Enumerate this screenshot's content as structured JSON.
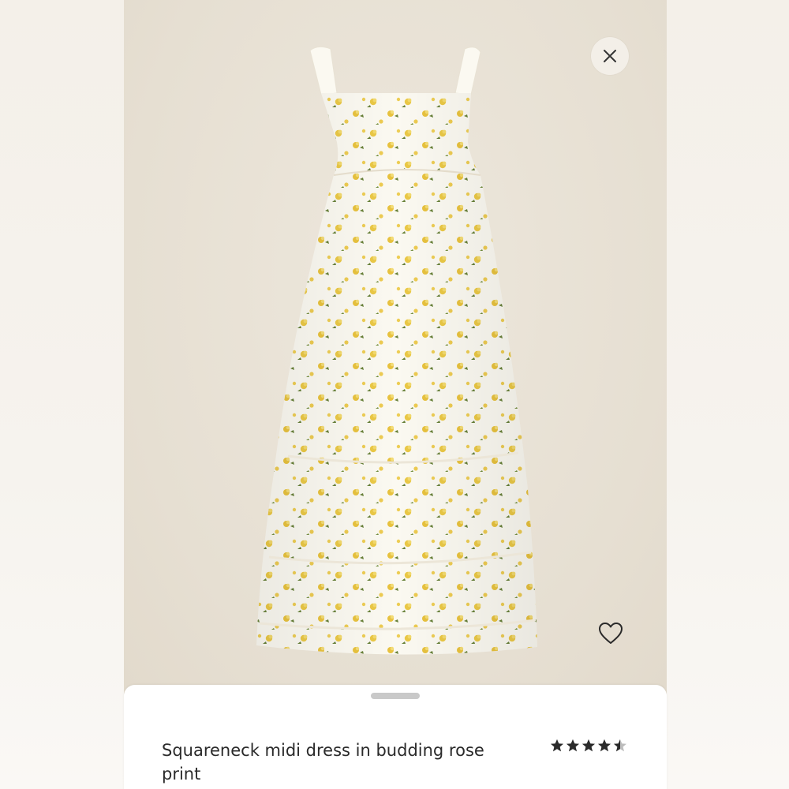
{
  "product": {
    "title": "Squareneck midi dress in budding rose print",
    "rating": 4.5,
    "rating_max": 5
  },
  "icons": {
    "close": "close-icon",
    "favorite": "heart-outline-icon",
    "star": "star-icon"
  },
  "colors": {
    "backdrop": "#e6dfd2",
    "dress": "#fbf9f1",
    "print_yellow": "#e9c53d",
    "print_green": "#5f7a2e",
    "star": "#2b2b2b"
  }
}
